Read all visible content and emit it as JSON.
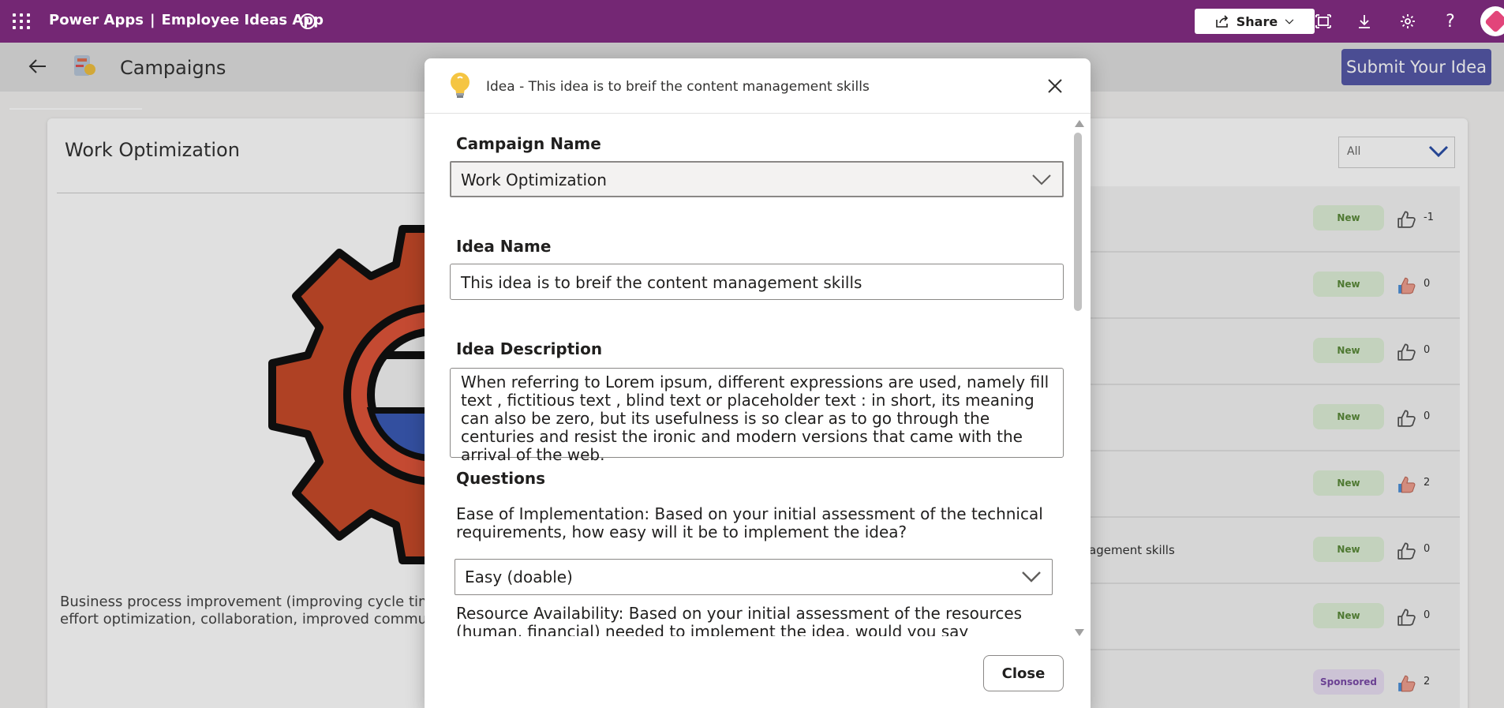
{
  "topbar": {
    "product": "Power Apps",
    "separator": "|",
    "app_name": "Employee Ideas App",
    "share_label": "Share",
    "icons": [
      "waffle-icon",
      "info-icon",
      "share-icon",
      "chevron-down-icon",
      "fit-screen-icon",
      "download-icon",
      "settings-icon",
      "help-icon",
      "avatar"
    ]
  },
  "header": {
    "title": "Campaigns",
    "submit_label": "Submit Your Idea"
  },
  "background": {
    "campaign_title": "Work Optimization",
    "description": "Business process improvement (improving cycle time, c effort optimization, collaboration, improved communic",
    "description_line1": "Business process improvement (improving cycle time, c",
    "description_line2": "effort optimization, collaboration, improved communic",
    "filter_value": "All",
    "ideas": [
      {
        "text": "",
        "status": "New",
        "votes": "-1",
        "liked": false
      },
      {
        "text": "",
        "status": "New",
        "votes": "0",
        "liked": true
      },
      {
        "text": "",
        "status": "New",
        "votes": "0",
        "liked": false
      },
      {
        "text": "",
        "status": "New",
        "votes": "0",
        "liked": false
      },
      {
        "text": "",
        "status": "New",
        "votes": "2",
        "liked": true
      },
      {
        "text": "agement skills",
        "status": "New",
        "votes": "0",
        "liked": false
      },
      {
        "text": "",
        "status": "New",
        "votes": "0",
        "liked": false
      },
      {
        "text": "",
        "status": "Sponsored",
        "votes": "2",
        "liked": true
      }
    ]
  },
  "modal": {
    "title": "Idea - This idea is to breif the content management skills",
    "campaign_name_label": "Campaign Name",
    "campaign_name_value": "Work Optimization",
    "idea_name_label": "Idea Name",
    "idea_name_value": "This idea is to breif the content management skills",
    "idea_description_label": "Idea Description",
    "idea_description_value": "When referring to Lorem ipsum, different expressions are used, namely fill text , fictitious text , blind text or placeholder text : in short, its meaning can also be zero, but its usefulness is so clear as to go through the centuries and resist the ironic and modern versions that came with the arrival of the web.",
    "questions_label": "Questions",
    "q1_text": "Ease of Implementation: Based on your initial assessment of the technical requirements, how easy will it be to implement the idea?",
    "q1_value": "Easy (doable)",
    "q2_text": "Resource Availability: Based on your initial assessment of the resources (human, financial) needed to implement the idea, would you say implementation will",
    "close_label": "Close"
  },
  "colors": {
    "topbar": "#742774",
    "submit_button": "#5558a8",
    "badge_new_bg": "#dff0d8",
    "badge_sponsored_bg": "#e9dff3"
  }
}
